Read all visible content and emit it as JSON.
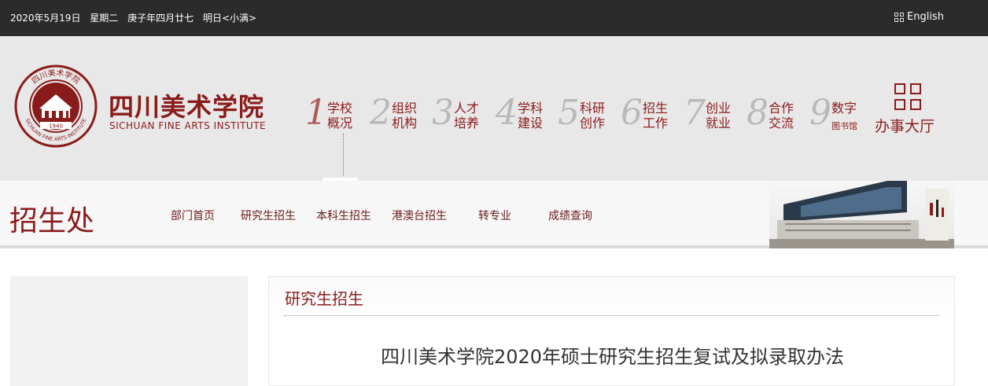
{
  "topbar": {
    "date": "2020年5月19日",
    "weekday": "星期二",
    "lunar": "庚子年四月廿七",
    "solar_term": "明日<小满>",
    "language_link": "English",
    "language_icon": "grid-icon"
  },
  "logo": {
    "title": "四川美术学院",
    "subtitle": "SICHUAN FINE ARTS INSTITUTE",
    "seal_text_top": "四川美术学院",
    "seal_text_bottom": "SICHUAN FINE ARTS INSTITUTE",
    "seal_year": "1940",
    "color": "#8a1b1b"
  },
  "main_nav": [
    {
      "num": "1",
      "line1": "学校",
      "line2": "概况"
    },
    {
      "num": "2",
      "line1": "组织",
      "line2": "机构"
    },
    {
      "num": "3",
      "line1": "人才",
      "line2": "培养"
    },
    {
      "num": "4",
      "line1": "学科",
      "line2": "建设"
    },
    {
      "num": "5",
      "line1": "科研",
      "line2": "创作"
    },
    {
      "num": "6",
      "line1": "招生",
      "line2": "工作"
    },
    {
      "num": "7",
      "line1": "创业",
      "line2": "就业"
    },
    {
      "num": "8",
      "line1": "合作",
      "line2": "交流"
    },
    {
      "num": "9",
      "line1": "数字",
      "line2": "图书馆"
    }
  ],
  "service_hall": {
    "label": "办事大厅",
    "icon": "grid-icon"
  },
  "department": {
    "name": "招生处"
  },
  "sub_nav": [
    "部门首页",
    "研究生招生",
    "本科生招生",
    "港澳台招生",
    "转专业",
    "成绩查询"
  ],
  "content": {
    "section_title": "研究生招生",
    "article_title": "四川美术学院2020年硕士研究生招生复试及拟录取办法"
  }
}
